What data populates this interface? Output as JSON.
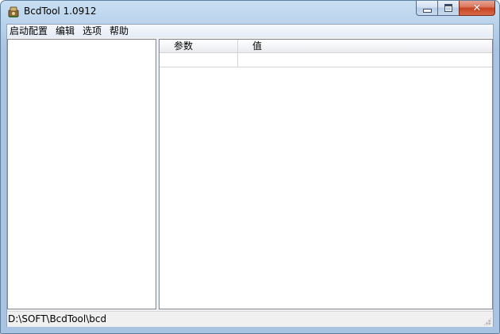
{
  "window": {
    "title": "BcdTool  1.0912",
    "app_icon": "bcdtool-icon",
    "controls": {
      "minimize_icon": "minimize-icon",
      "maximize_icon": "maximize-icon",
      "close_icon": "close-icon",
      "close_glyph": "✕"
    }
  },
  "menu": {
    "items": [
      {
        "label": "启动配置"
      },
      {
        "label": "编辑"
      },
      {
        "label": "选项"
      },
      {
        "label": "帮助"
      }
    ]
  },
  "list": {
    "columns": [
      {
        "label": "参数"
      },
      {
        "label": "值"
      }
    ],
    "rows": [
      {
        "param": "",
        "value": ""
      }
    ]
  },
  "status": {
    "path": "D:\\SOFT\\BcdTool\\bcd"
  },
  "colors": {
    "close_button": "#c7411f",
    "title_gradient_top": "#c9dff2",
    "client_bg": "#f0f0f0"
  }
}
